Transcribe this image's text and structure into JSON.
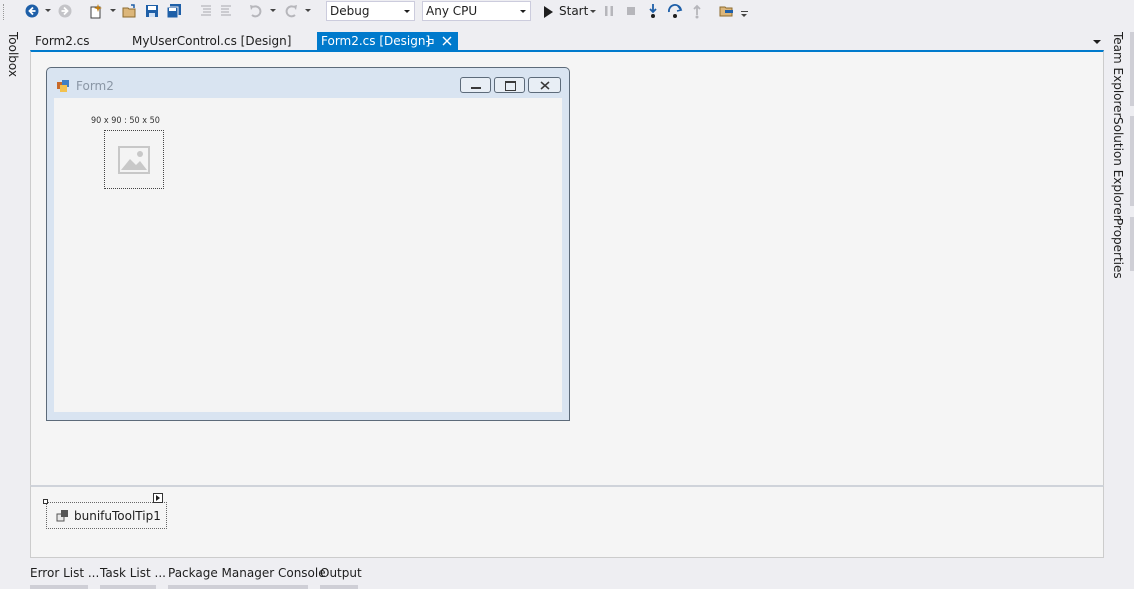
{
  "toolbar": {
    "configuration": "Debug",
    "platform": "Any CPU",
    "start_label": "Start"
  },
  "side_left": {
    "toolbox": "Toolbox"
  },
  "side_right": {
    "team_explorer": "Team Explorer",
    "solution_explorer": "Solution Explorer",
    "properties": "Properties"
  },
  "tabs": [
    {
      "label": "Form2.cs"
    },
    {
      "label": "MyUserControl.cs [Design]"
    },
    {
      "label": "Form2.cs [Design]",
      "active": true
    }
  ],
  "designer": {
    "form_title": "Form2",
    "picture_label": "90 x 90 : 50 x 50"
  },
  "component_tray": {
    "component_name": "bunifuToolTip1"
  },
  "bottom_tabs": [
    {
      "label": "Error List ..."
    },
    {
      "label": "Task List ..."
    },
    {
      "label": "Package Manager Console"
    },
    {
      "label": "Output"
    }
  ],
  "colors": {
    "accent": "#007acc",
    "background": "#eeeef2"
  }
}
